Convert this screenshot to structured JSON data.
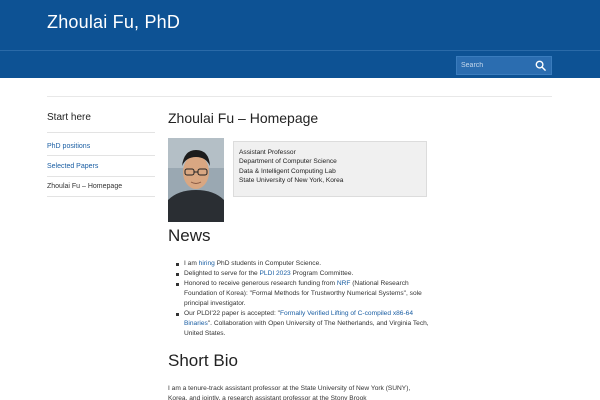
{
  "site": {
    "title": "Zhoulai Fu, PhD"
  },
  "search": {
    "placeholder": "Search"
  },
  "sidebar": {
    "heading": "Start here",
    "items": [
      {
        "label": "PhD positions",
        "link": true
      },
      {
        "label": "Selected Papers",
        "link": true
      },
      {
        "label": "Zhoulai Fu – Homepage",
        "link": false
      }
    ]
  },
  "main": {
    "title": "Zhoulai Fu – Homepage",
    "info": [
      "Assistant Professor",
      "Department of Computer Science",
      "Data & Intelligent Computing Lab",
      "State University of New York, Korea"
    ],
    "news_heading": "News",
    "news": {
      "n1_pre": "I am ",
      "n1_link": "hiring",
      "n1_post": " PhD students in Computer Science.",
      "n2_pre": "Delighted to serve for the ",
      "n2_link": "PLDI 2023",
      "n2_post": " Program Committee.",
      "n3_pre": "Honored to receive generous research funding from ",
      "n3_link": "NRF",
      "n3_post": " (National Research Foundation of Korea): \"Formal Methods for Trustworthy Numerical Systems\", sole principal investigator.",
      "n4_pre": "Our PLDI'22 paper is accepted: \"",
      "n4_link": "Formally Verified Lifting of C-compiled x86-64 Binaries",
      "n4_post": "\". Collaboration with Open University of The Netherlands, and Virginia Tech, United States."
    },
    "bio_heading": "Short Bio",
    "bio_text": "I am a tenure-track assistant professor at the State University of New York (SUNY), Korea, and jointly, a research assistant professor at the Stony Brook"
  },
  "colors": {
    "header": "#0d5294",
    "link": "#1a5ea3"
  }
}
